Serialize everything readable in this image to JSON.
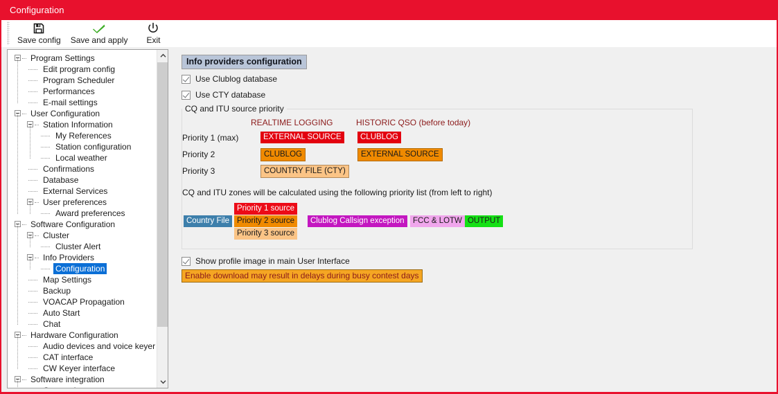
{
  "window": {
    "title": "Configuration",
    "accent_color": "#e8112d"
  },
  "toolbar": {
    "buttons": [
      {
        "label": "Save config",
        "icon": "floppy-disk-icon"
      },
      {
        "label": "Save and apply",
        "icon": "green-check-icon"
      },
      {
        "label": "Exit",
        "icon": "power-icon"
      }
    ]
  },
  "sidebar": {
    "selected": "Configuration",
    "selected_color": "#0b6fd6",
    "items": [
      {
        "label": "Program Settings",
        "level": 0,
        "expander": true
      },
      {
        "label": "Edit program config",
        "level": 1,
        "expander": false
      },
      {
        "label": "Program Scheduler",
        "level": 1,
        "expander": false
      },
      {
        "label": "Performances",
        "level": 1,
        "expander": false
      },
      {
        "label": "E-mail settings",
        "level": 1,
        "expander": false
      },
      {
        "label": "User Configuration",
        "level": 0,
        "expander": true
      },
      {
        "label": "Station Information",
        "level": 1,
        "expander": true
      },
      {
        "label": "My References",
        "level": 2,
        "expander": false
      },
      {
        "label": "Station configuration",
        "level": 2,
        "expander": false
      },
      {
        "label": "Local weather",
        "level": 2,
        "expander": false
      },
      {
        "label": "Confirmations",
        "level": 1,
        "expander": false
      },
      {
        "label": "Database",
        "level": 1,
        "expander": false
      },
      {
        "label": "External Services",
        "level": 1,
        "expander": false
      },
      {
        "label": "User preferences",
        "level": 1,
        "expander": true
      },
      {
        "label": "Award preferences",
        "level": 2,
        "expander": false
      },
      {
        "label": "Software Configuration",
        "level": 0,
        "expander": true
      },
      {
        "label": "Cluster",
        "level": 1,
        "expander": true
      },
      {
        "label": "Cluster Alert",
        "level": 2,
        "expander": false
      },
      {
        "label": "Info Providers",
        "level": 1,
        "expander": true
      },
      {
        "label": "Configuration",
        "level": 2,
        "expander": false,
        "selected": true
      },
      {
        "label": "Map Settings",
        "level": 1,
        "expander": false
      },
      {
        "label": "Backup",
        "level": 1,
        "expander": false
      },
      {
        "label": "VOACAP Propagation",
        "level": 1,
        "expander": false
      },
      {
        "label": "Auto Start",
        "level": 1,
        "expander": false
      },
      {
        "label": "Chat",
        "level": 1,
        "expander": false
      },
      {
        "label": "Hardware Configuration",
        "level": 0,
        "expander": true
      },
      {
        "label": "Audio devices and voice keyer",
        "level": 1,
        "expander": false
      },
      {
        "label": "CAT interface",
        "level": 1,
        "expander": false
      },
      {
        "label": "CW Keyer interface",
        "level": 1,
        "expander": false
      },
      {
        "label": "Software integration",
        "level": 0,
        "expander": true
      },
      {
        "label": "Connections",
        "level": 1,
        "expander": false
      }
    ]
  },
  "main": {
    "panel_title": "Info providers configuration",
    "checkbox_clublog": {
      "label": "Use Clublog database",
      "checked": true
    },
    "checkbox_cty": {
      "label": "Use CTY database",
      "checked": true
    },
    "group": {
      "legend": "CQ and ITU source priority",
      "columns": [
        "REALTIME LOGGING",
        "HISTORIC QSO (before today)"
      ],
      "rows": [
        {
          "label": "Priority 1 (max)",
          "realtime": "EXTERNAL SOURCE",
          "historic": "CLUBLOG",
          "level": "p1"
        },
        {
          "label": "Priority 2",
          "realtime": "CLUBLOG",
          "historic": "EXTERNAL SOURCE",
          "level": "p2"
        },
        {
          "label": "Priority 3",
          "realtime": "COUNTRY FILE (CTY)",
          "historic": "",
          "level": "p3"
        }
      ],
      "flow_note": "CQ and ITU zones will be calculated using the following priority list (from left to right)",
      "flow": {
        "country_file": "Country File",
        "priority1": "Priority 1 source",
        "priority2": "Priority 2 source",
        "priority3": "Priority 3 source",
        "exception": "Clublog Callsign exception",
        "fcc_lotw": "FCC & LOTW",
        "output": "OUTPUT"
      }
    },
    "checkbox_profile": {
      "label": "Show profile image in main User Interface",
      "checked": true
    },
    "warning": "Enable download may result in delays during busy contest days"
  },
  "colors": {
    "priority1": "#e3000f",
    "priority2": "#f08a00",
    "priority3": "#fbc486",
    "country_file": "#3d7fab",
    "exception": "#c317c0",
    "fcc_lotw": "#f0a6ec",
    "output": "#15e015",
    "warning_bg": "#f5a623",
    "warning_fg": "#8b1a1a"
  }
}
